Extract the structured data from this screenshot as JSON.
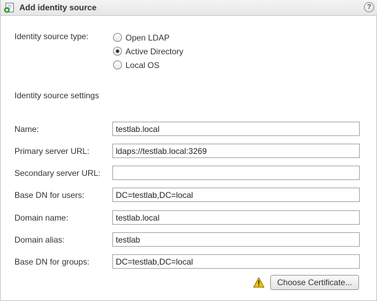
{
  "dialog": {
    "title": "Add identity source",
    "help_symbol": "?",
    "title_icon": "add-identity-source-icon"
  },
  "source_type": {
    "label": "Identity source type:",
    "options": [
      {
        "label": "Open LDAP",
        "selected": false
      },
      {
        "label": "Active Directory",
        "selected": true
      },
      {
        "label": "Local OS",
        "selected": false
      }
    ]
  },
  "settings": {
    "heading": "Identity source settings",
    "fields": {
      "name": {
        "label": "Name:",
        "value": "testlab.local"
      },
      "primary_url": {
        "label": "Primary server URL:",
        "value": "ldaps://testlab.local:3269"
      },
      "secondary_url": {
        "label": "Secondary server URL:",
        "value": ""
      },
      "base_dn_users": {
        "label": "Base DN for users:",
        "value": "DC=testlab,DC=local"
      },
      "domain_name": {
        "label": "Domain name:",
        "value": "testlab.local"
      },
      "domain_alias": {
        "label": "Domain alias:",
        "value": "testlab"
      },
      "base_dn_groups": {
        "label": "Base DN for groups:",
        "value": "DC=testlab,DC=local"
      }
    }
  },
  "certificate": {
    "warning_icon": "warning-icon",
    "button_label": "Choose Certificate..."
  },
  "colors": {
    "warning_fill": "#f5c400",
    "titlebar_bg": "#ececec",
    "field_border": "#a9a9a9"
  }
}
